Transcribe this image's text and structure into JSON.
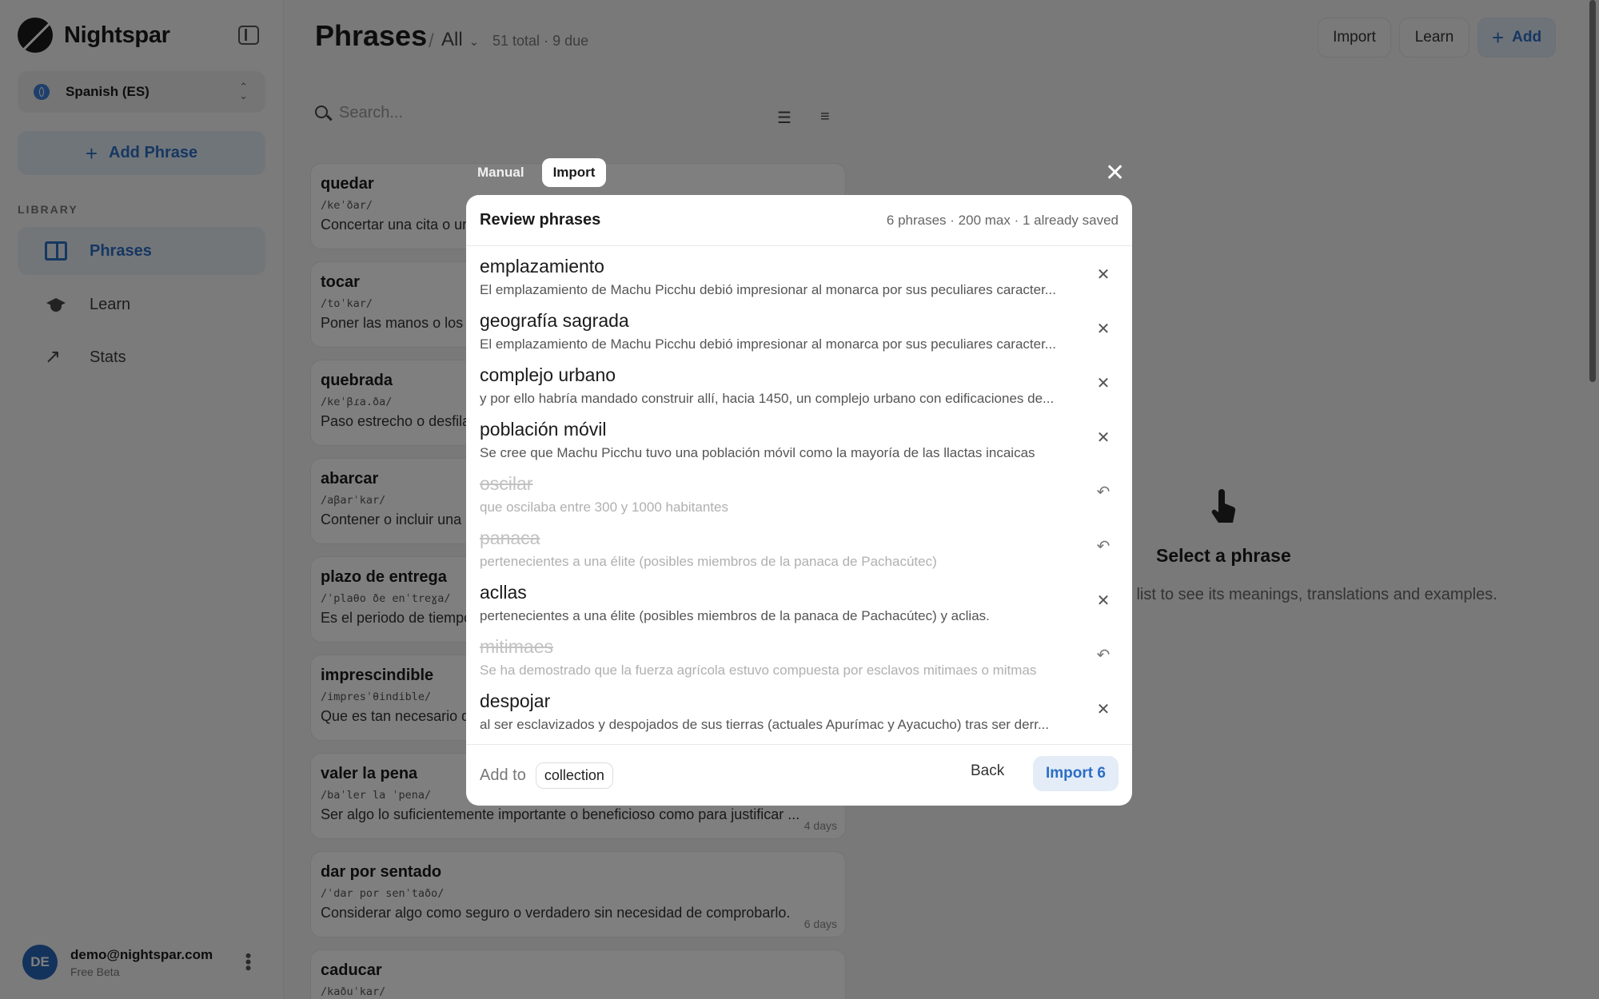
{
  "app": {
    "name": "Nightspar"
  },
  "sidebar": {
    "language": "Spanish (ES)",
    "add_phrase_label": "Add Phrase",
    "library_heading": "LIBRARY",
    "items": [
      {
        "label": "Phrases",
        "icon": "book-icon",
        "active": true
      },
      {
        "label": "Learn",
        "icon": "graduation-cap-icon",
        "active": false
      },
      {
        "label": "Stats",
        "icon": "trending-up-icon",
        "active": false
      }
    ],
    "user": {
      "initials": "DE",
      "email": "demo@nightspar.com",
      "plan": "Free Beta"
    }
  },
  "header": {
    "title": "Phrases",
    "separator": "/",
    "filter": "All",
    "total": "51 total",
    "due": "9 due",
    "count_separator": "·",
    "buttons": {
      "import": "Import",
      "learn": "Learn",
      "add": "Add"
    }
  },
  "search": {
    "placeholder": "Search..."
  },
  "phrase_list": [
    {
      "word": "quedar",
      "ipa": "/keˈðar/",
      "definition": "Concertar una cita o un",
      "due": ""
    },
    {
      "word": "tocar",
      "ipa": "/toˈkar/",
      "definition": "Poner las manos o los d",
      "due": ""
    },
    {
      "word": "quebrada",
      "ipa": "/keˈβɾa.ða/",
      "definition": "Paso estrecho o desfila",
      "due": ""
    },
    {
      "word": "abarcar",
      "ipa": "/aβarˈkar/",
      "definition": "Contener o incluir una c",
      "due": ""
    },
    {
      "word": "plazo de entrega",
      "ipa": "/ˈplaθo ðe enˈtreɣa/",
      "definition": "Es el periodo de tiempo",
      "due": ""
    },
    {
      "word": "imprescindible",
      "ipa": "/impresˈθindible/",
      "definition": "Que es tan necesario q",
      "due": ""
    },
    {
      "word": "valer la pena",
      "ipa": "/baˈler la ˈpena/",
      "definition": "Ser algo lo suficientemente importante o beneficioso como para justificar ...",
      "due": "4 days"
    },
    {
      "word": "dar por sentado",
      "ipa": "/ˈdar por senˈtaðo/",
      "definition": "Considerar algo como seguro o verdadero sin necesidad de comprobarlo.",
      "due": "6 days"
    },
    {
      "word": "caducar",
      "ipa": "/kaðuˈkar/",
      "definition": "",
      "due": ""
    }
  ],
  "empty_state": {
    "title": "Select a phrase",
    "subtitle": "Select a phrase from the list to see its meanings, translations and examples."
  },
  "modal": {
    "tabs": [
      "Manual",
      "Import"
    ],
    "active_tab": "Import",
    "title": "Review phrases",
    "meta": "6 phrases · 200 max · 1 already saved",
    "rows": [
      {
        "term": "emplazamiento",
        "context": "El emplazamiento de Machu Picchu debió impresionar al monarca por sus peculiares caracter...",
        "removed": false
      },
      {
        "term": "geografía sagrada",
        "context": "El emplazamiento de Machu Picchu debió impresionar al monarca por sus peculiares caracter...",
        "removed": false
      },
      {
        "term": "complejo urbano",
        "context": "y por ello habría mandado construir allí, hacia 1450, un complejo urbano con edificaciones de...",
        "removed": false
      },
      {
        "term": "población móvil",
        "context": "Se cree que Machu Picchu tuvo una población móvil como la mayoría de las llactas incaicas",
        "removed": false
      },
      {
        "term": "oscilar",
        "context": "que oscilaba entre 300 y 1000 habitantes",
        "removed": true
      },
      {
        "term": "panaca",
        "context": "pertenecientes a una élite (posibles miembros de la panaca de Pachacútec)",
        "removed": true
      },
      {
        "term": "acllas",
        "context": "pertenecientes a una élite (posibles miembros de la panaca de Pachacútec) y aclias.",
        "removed": false
      },
      {
        "term": "mitimaes",
        "context": "Se ha demostrado que la fuerza agrícola estuvo compuesta por esclavos mitimaes o mitmas",
        "removed": true
      },
      {
        "term": "despojar",
        "context": "al ser esclavizados y despojados de sus tierras (actuales Apurímac y Ayacucho) tras ser derr...",
        "removed": false
      }
    ],
    "footer": {
      "add_to_label": "Add to",
      "collection_chip": "collection",
      "back": "Back",
      "import": "Import 6"
    }
  },
  "colors": {
    "accent": "#2d6ec4",
    "avatar": "#2867b8",
    "overlay": "rgba(0,0,0,0.5)"
  }
}
